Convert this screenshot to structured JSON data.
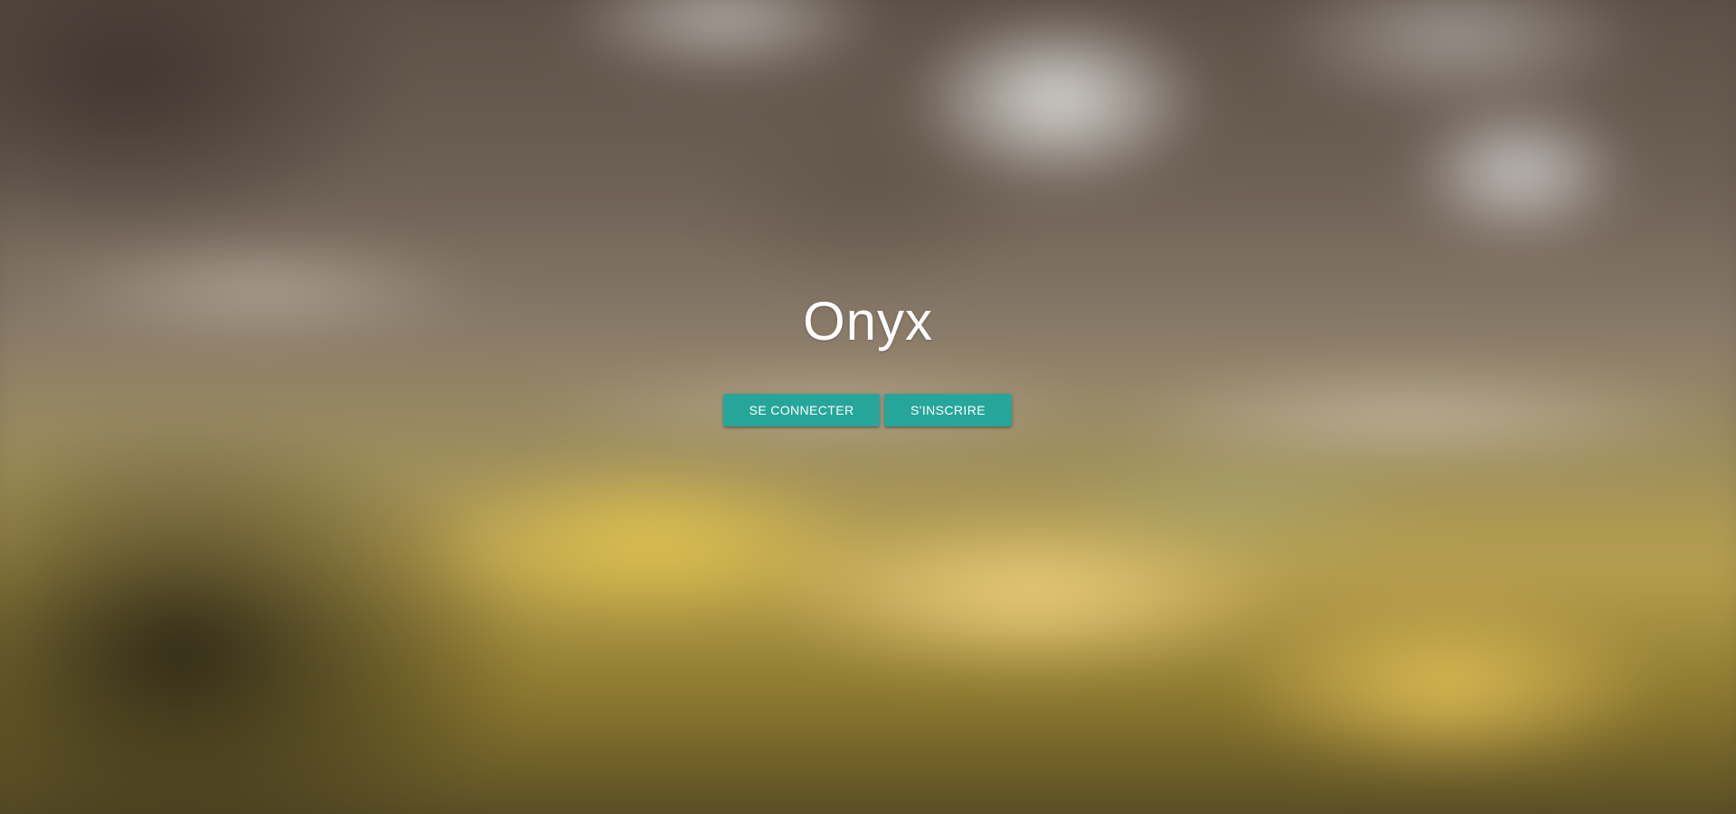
{
  "app": {
    "title": "Onyx"
  },
  "actions": {
    "login_label": "SE CONNECTER",
    "signup_label": "S'INSCRIRE"
  },
  "colors": {
    "accent": "#26a69a",
    "title_text": "#ffffff"
  },
  "background": {
    "description_icon": "blurred-landscape-image"
  }
}
